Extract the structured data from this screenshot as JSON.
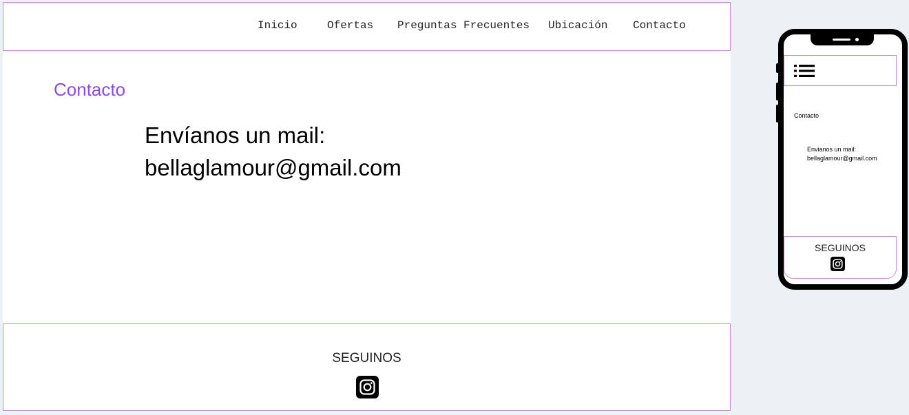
{
  "nav": {
    "items": [
      {
        "label": "Inicio"
      },
      {
        "label": "Ofertas"
      },
      {
        "label": "Preguntas Frecuentes"
      },
      {
        "label": "Ubicación"
      },
      {
        "label": "Contacto"
      }
    ]
  },
  "main": {
    "title": "Contacto",
    "mail_line1": "Envíanos un mail:",
    "mail_line2": "bellaglamour@gmail.com"
  },
  "footer": {
    "title": "SEGUINOS",
    "social_icon": "instagram-icon"
  },
  "phone": {
    "menu_icon": "hamburger-list-icon",
    "title": "Contacto",
    "mail_line1": "Envianos un mail:",
    "mail_line2": "bellaglamour@gmail.com",
    "footer_title": "SEGUINOS",
    "social_icon": "instagram-icon"
  },
  "colors": {
    "accent": "#8e4be0",
    "border": "#c58cd6",
    "background": "#edf0f5"
  }
}
